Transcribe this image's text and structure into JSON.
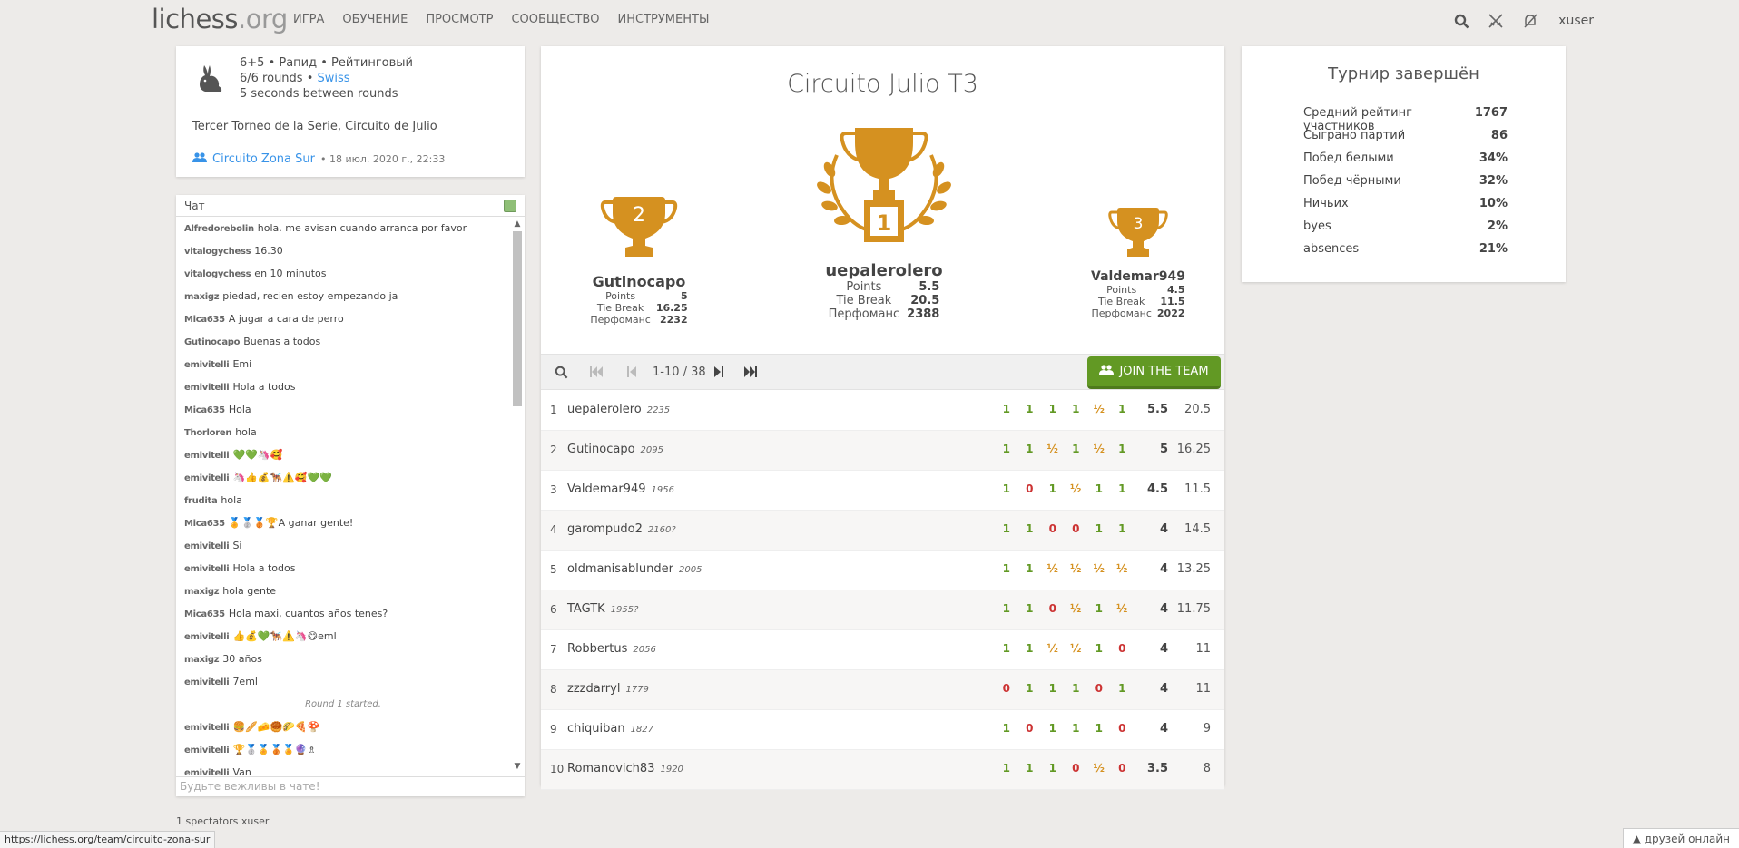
{
  "header": {
    "logo_main": "lichess",
    "logo_tld": ".org",
    "nav": [
      "ИГРА",
      "ОБУЧЕНИЕ",
      "ПРОСМОТР",
      "СООБЩЕСТВО",
      "ИНСТРУМЕНТЫ"
    ],
    "username": "xuser"
  },
  "info": {
    "line1": "6+5 • Рапид • Рейтинговый",
    "rounds": "6/6 rounds •",
    "system": "Swiss",
    "between": "5 seconds between rounds",
    "description": "Tercer Torneo de la Serie, Circuito de Julio",
    "team": "Circuito Zona Sur",
    "date": "• 18 июл. 2020 г., 22:33"
  },
  "chat": {
    "title": "Чат",
    "placeholder": "Будьте вежливы в чате!",
    "messages": [
      {
        "user": "Alfredorebolin",
        "text": "hola. me avisan cuando arranca por favor"
      },
      {
        "user": "vitalogychess",
        "text": "16.30"
      },
      {
        "user": "vitalogychess",
        "text": "en 10 minutos"
      },
      {
        "user": "maxigz",
        "text": "piedad, recien estoy empezando ja"
      },
      {
        "user": "Mica635",
        "text": "A jugar a cara de perro"
      },
      {
        "user": "Gutinocapo",
        "text": "Buenas a todos"
      },
      {
        "user": "emivitelli",
        "text": "Emi"
      },
      {
        "user": "emivitelli",
        "text": "Hola a todos"
      },
      {
        "user": "Mica635",
        "text": "Hola"
      },
      {
        "user": "Thorloren",
        "text": "hola"
      },
      {
        "user": "emivitelli",
        "text": "💚💚🦄🥰"
      },
      {
        "user": "emivitelli",
        "text": "🦄👍💰🐕‍🦺⚠️🥰💚💚"
      },
      {
        "user": "frudita",
        "text": "hola"
      },
      {
        "user": "Mica635",
        "text": "🏅🥈🥉🏆A ganar gente!"
      },
      {
        "user": "emivitelli",
        "text": "Si"
      },
      {
        "user": "emivitelli",
        "text": "Hola a todos"
      },
      {
        "user": "maxigz",
        "text": "hola gente"
      },
      {
        "user": "Mica635",
        "text": "Hola maxi, cuantos años tenes?"
      },
      {
        "user": "emivitelli",
        "text": "👍💰💚🐕‍🦺⚠️🦄😋eml"
      },
      {
        "user": "maxigz",
        "text": "30 años"
      },
      {
        "user": "emivitelli",
        "text": "7eml"
      },
      {
        "user": "",
        "text": "Round 1 started.",
        "system": true
      },
      {
        "user": "emivitelli",
        "text": "🍔🥖🧀🥮🌮🍕🍄"
      },
      {
        "user": "emivitelli",
        "text": "🏆🥈🏅🥉🏅🔮♗"
      },
      {
        "user": "emivitelli",
        "text": "Van"
      }
    ]
  },
  "spectators": "1 spectators xuser",
  "tournament": {
    "title": "Circuito Julio T3",
    "podium": [
      {
        "place": "2",
        "name": "Gutinocapo",
        "points_label": "Points",
        "points": "5",
        "tb_label": "Tie Break",
        "tb": "16.25",
        "perf_label": "Перфоманс",
        "perf": "2232"
      },
      {
        "place": "1",
        "name": "uepalerolero",
        "points_label": "Points",
        "points": "5.5",
        "tb_label": "Tie Break",
        "tb": "20.5",
        "perf_label": "Перфоманс",
        "perf": "2388"
      },
      {
        "place": "3",
        "name": "Valdemar949",
        "points_label": "Points",
        "points": "4.5",
        "tb_label": "Tie Break",
        "tb": "11.5",
        "perf_label": "Перфоманс",
        "perf": "2022"
      }
    ],
    "pager_label": "1-10 / 38",
    "join_label": "JOIN THE TEAM",
    "standings": [
      {
        "rank": "1",
        "name": "uepalerolero",
        "rating": "2235",
        "results": [
          "1",
          "1",
          "1",
          "1",
          "½",
          "1"
        ],
        "points": "5.5",
        "tb": "20.5"
      },
      {
        "rank": "2",
        "name": "Gutinocapo",
        "rating": "2095",
        "results": [
          "1",
          "1",
          "½",
          "1",
          "½",
          "1"
        ],
        "points": "5",
        "tb": "16.25"
      },
      {
        "rank": "3",
        "name": "Valdemar949",
        "rating": "1956",
        "results": [
          "1",
          "0",
          "1",
          "½",
          "1",
          "1"
        ],
        "points": "4.5",
        "tb": "11.5"
      },
      {
        "rank": "4",
        "name": "garompudo2",
        "rating": "2160?",
        "results": [
          "1",
          "1",
          "0",
          "0",
          "1",
          "1"
        ],
        "points": "4",
        "tb": "14.5"
      },
      {
        "rank": "5",
        "name": "oldmanisablunder",
        "rating": "2005",
        "results": [
          "1",
          "1",
          "½",
          "½",
          "½",
          "½"
        ],
        "points": "4",
        "tb": "13.25"
      },
      {
        "rank": "6",
        "name": "TAGTK",
        "rating": "1955?",
        "results": [
          "1",
          "1",
          "0",
          "½",
          "1",
          "½"
        ],
        "points": "4",
        "tb": "11.75"
      },
      {
        "rank": "7",
        "name": "Robbertus",
        "rating": "2056",
        "results": [
          "1",
          "1",
          "½",
          "½",
          "1",
          "0"
        ],
        "points": "4",
        "tb": "11"
      },
      {
        "rank": "8",
        "name": "zzzdarryl",
        "rating": "1779",
        "results": [
          "0",
          "1",
          "1",
          "1",
          "0",
          "1"
        ],
        "points": "4",
        "tb": "11"
      },
      {
        "rank": "9",
        "name": "chiquiban",
        "rating": "1827",
        "results": [
          "1",
          "0",
          "1",
          "1",
          "1",
          "0"
        ],
        "points": "4",
        "tb": "9"
      },
      {
        "rank": "10",
        "name": "Romanovich83",
        "rating": "1920",
        "results": [
          "1",
          "1",
          "1",
          "0",
          "½",
          "0"
        ],
        "points": "3.5",
        "tb": "8"
      }
    ]
  },
  "stats": {
    "title": "Турнир завершён",
    "rows": [
      {
        "label": "Средний рейтинг участников",
        "value": "1767"
      },
      {
        "label": "Сыграно партий",
        "value": "86"
      },
      {
        "label": "Побед белыми",
        "value": "34%"
      },
      {
        "label": "Побед чёрными",
        "value": "32%"
      },
      {
        "label": "Ничьих",
        "value": "10%"
      },
      {
        "label": "byes",
        "value": "2%"
      },
      {
        "label": "absences",
        "value": "21%"
      }
    ]
  },
  "footer": {
    "status_url": "https://lichess.org/team/circuito-zona-sur",
    "friends": "друзей онлайн"
  },
  "colors": {
    "win": "#629924",
    "loss": "#cc3333",
    "draw": "#d59120",
    "trophy": "#d59120",
    "link": "#3893e8"
  }
}
